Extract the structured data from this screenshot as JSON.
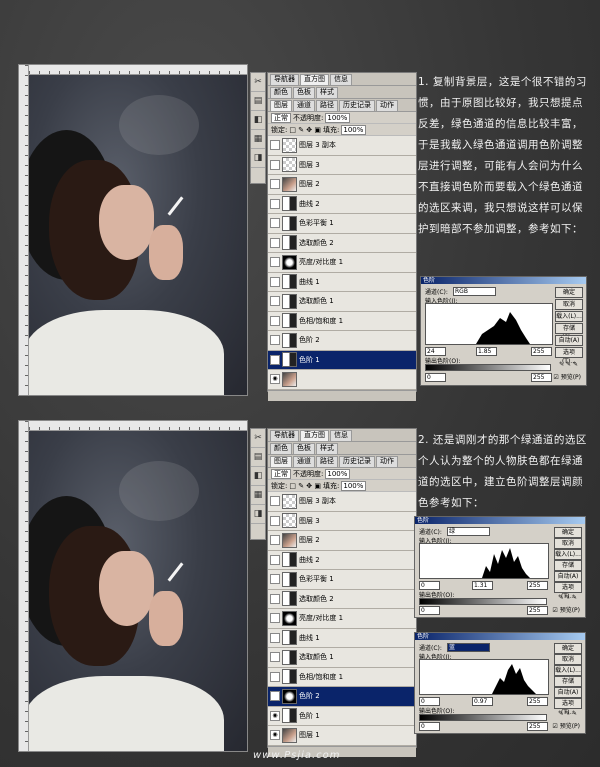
{
  "watermark": "www.Psjia.com",
  "section1": {
    "panel_tabs_top": [
      "导航器",
      "直方图",
      "信息"
    ],
    "panel_tabs": [
      "颜色",
      "色板",
      "样式"
    ],
    "layer_tabs": [
      "图层",
      "通道",
      "路径",
      "历史记录",
      "动作"
    ],
    "blend_mode": "正常",
    "opacity_label": "不透明度:",
    "opacity_value": "100%",
    "lock_label": "锁定:",
    "fill_label": "填充:",
    "fill_value": "100%",
    "layers": [
      {
        "name": "图层 3 副本",
        "thumb": "trans",
        "eye": false,
        "active": false
      },
      {
        "name": "图层 3",
        "thumb": "trans",
        "eye": false,
        "active": false
      },
      {
        "name": "图层 2",
        "thumb": "photo-t",
        "eye": false,
        "active": false
      },
      {
        "name": "曲线 2",
        "thumb": "adj",
        "eye": false,
        "active": false
      },
      {
        "name": "色彩平衡 1",
        "thumb": "adj",
        "eye": false,
        "active": false
      },
      {
        "name": "选取颜色 2",
        "thumb": "adj",
        "eye": false,
        "active": false
      },
      {
        "name": "亮度/对比度 1",
        "thumb": "mask",
        "eye": false,
        "active": false
      },
      {
        "name": "曲线 1",
        "thumb": "adj",
        "eye": false,
        "active": false
      },
      {
        "name": "选取颜色 1",
        "thumb": "adj",
        "eye": false,
        "active": false
      },
      {
        "name": "色相/饱和度 1",
        "thumb": "adj",
        "eye": false,
        "active": false
      },
      {
        "name": "色阶 2",
        "thumb": "adj",
        "eye": false,
        "active": false
      },
      {
        "name": "色阶 1",
        "thumb": "adj",
        "eye": true,
        "active": true
      },
      {
        "name": "",
        "thumb": "photo-t",
        "eye": true,
        "active": false
      }
    ],
    "text": "1. 复制背景层，这是个很不错的习惯，由于原图比较好，我只想提点反差，绿色通道的信息比较丰富，于是我载入绿色通道调用色阶调整层进行调整，可能有人会问为什么不直接调色阶而要载入个绿色通道的选区来调，我只想说这样可以保护到暗部不参加调整，参考如下：",
    "dialog": {
      "title": "色阶",
      "channel_label": "通道(C):",
      "channel_value": "RGB",
      "input_label": "输入色阶(I):",
      "inputs": [
        "24",
        "1.85",
        "255"
      ],
      "output_label": "输出色阶(O):",
      "outputs": [
        "0",
        "255"
      ],
      "buttons": [
        "确定",
        "取消",
        "载入(L)...",
        "存储(S)...",
        "自动(A)",
        "选项(T)..."
      ],
      "preview_label": "预览(P)"
    }
  },
  "section2": {
    "panel_tabs_top": [
      "导航器",
      "直方图",
      "信息"
    ],
    "panel_tabs": [
      "颜色",
      "色板",
      "样式"
    ],
    "layer_tabs": [
      "图层",
      "通道",
      "路径",
      "历史记录",
      "动作"
    ],
    "blend_mode": "正常",
    "opacity_label": "不透明度:",
    "opacity_value": "100%",
    "lock_label": "锁定:",
    "fill_label": "填充:",
    "fill_value": "100%",
    "layers": [
      {
        "name": "图层 3 副本",
        "thumb": "trans",
        "eye": false,
        "active": false
      },
      {
        "name": "图层 3",
        "thumb": "trans",
        "eye": false,
        "active": false
      },
      {
        "name": "图层 2",
        "thumb": "photo-t",
        "eye": false,
        "active": false
      },
      {
        "name": "曲线 2",
        "thumb": "adj",
        "eye": false,
        "active": false
      },
      {
        "name": "色彩平衡 1",
        "thumb": "adj",
        "eye": false,
        "active": false
      },
      {
        "name": "选取颜色 2",
        "thumb": "adj",
        "eye": false,
        "active": false
      },
      {
        "name": "亮度/对比度 1",
        "thumb": "mask",
        "eye": false,
        "active": false
      },
      {
        "name": "曲线 1",
        "thumb": "adj",
        "eye": false,
        "active": false
      },
      {
        "name": "选取颜色 1",
        "thumb": "adj",
        "eye": false,
        "active": false
      },
      {
        "name": "色相/饱和度 1",
        "thumb": "adj",
        "eye": false,
        "active": false
      },
      {
        "name": "色阶 2",
        "thumb": "mask",
        "eye": true,
        "active": true
      },
      {
        "name": "色阶 1",
        "thumb": "adj",
        "eye": true,
        "active": false
      },
      {
        "name": "图层 1",
        "thumb": "photo-t",
        "eye": true,
        "active": false
      }
    ],
    "text": "2. 还是调刚才的那个绿通道的选区个人认为整个的人物肤色都在绿通道的选区中，建立色阶调整层调颜色参考如下：",
    "dialog_a": {
      "title": "色阶",
      "channel_label": "通道(C):",
      "channel_value": "绿",
      "input_label": "输入色阶(I):",
      "inputs": [
        "0",
        "1.31",
        "255"
      ],
      "output_label": "输出色阶(O):",
      "outputs": [
        "0",
        "255"
      ],
      "buttons": [
        "确定",
        "取消",
        "载入(L)...",
        "存储(S)...",
        "自动(A)",
        "选项(T)..."
      ],
      "preview_label": "预览(P)"
    },
    "dialog_b": {
      "title": "色阶",
      "channel_label": "通道(C):",
      "channel_value": "蓝",
      "input_label": "输入色阶(I):",
      "inputs": [
        "0",
        "0.97",
        "255"
      ],
      "output_label": "输出色阶(O):",
      "outputs": [
        "0",
        "255"
      ],
      "buttons": [
        "确定",
        "取消",
        "载入(L)...",
        "存储(S)...",
        "自动(A)",
        "选项(T)..."
      ],
      "preview_label": "预览(P)"
    }
  }
}
